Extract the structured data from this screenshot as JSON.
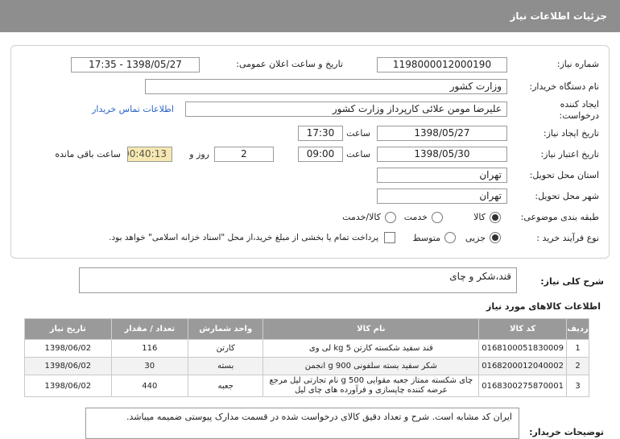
{
  "header": {
    "title": "جزئیات اطلاعات نیاز"
  },
  "form": {
    "need_number_label": "شماره نیاز:",
    "need_number": "1198000012000190",
    "announce_label": "تاریخ و ساعت اعلان عمومی:",
    "announce_value": "1398/05/27 - 17:35",
    "buyer_org_label": "نام دستگاه خریدار:",
    "buyer_org": "وزارت کشور",
    "creator_label_1": "ایجاد کننده",
    "creator_label_2": "درخواست:",
    "creator": "علیرضا مومن علائی کارپرداز وزارت کشور",
    "contact_link": "اطلاعات تماس خریدار",
    "created_date_label": "تاریخ ایجاد نیاز:",
    "created_date": "1398/05/27",
    "time_label": "ساعت",
    "created_time": "17:30",
    "valid_date_label": "تاریخ اعتبار نیاز:",
    "valid_date": "1398/05/30",
    "valid_time": "09:00",
    "days": "2",
    "days_label": "روز و",
    "remaining_time": "00:40:13",
    "remaining_label": "ساعت باقی مانده",
    "province_label": "استان محل تحویل:",
    "province": "تهران",
    "city_label": "شهر محل تحویل:",
    "city": "تهران",
    "category_label": "طبقه بندی موضوعی:",
    "category_options": [
      "کالا",
      "خدمت",
      "کالا/خدمت"
    ],
    "category_selected": 0,
    "process_label": "نوع فرآیند خرید :",
    "process_options": [
      "جزیی",
      "متوسط"
    ],
    "process_selected": 0,
    "payment_note": "پرداخت تمام یا بخشی از مبلغ خرید،از محل \"اسناد خزانه اسلامی\" خواهد بود."
  },
  "summary": {
    "label": "شرح کلی نیاز:",
    "value": "قند،شکر و چای"
  },
  "items_section": {
    "title": "اطلاعات کالاهای مورد نیاز",
    "columns": [
      "ردیف",
      "کد کالا",
      "نام کالا",
      "واحد شمارش",
      "تعداد / مقدار",
      "تاریخ نیاز"
    ],
    "rows": [
      [
        "1",
        "0168100051830009",
        "قند سفید شکسته کارتن 5 kg لی وی",
        "کارتن",
        "116",
        "1398/06/02"
      ],
      [
        "2",
        "0168200012040002",
        "شکر سفید بسته سلفونی 900 g انجمن",
        "بسته",
        "30",
        "1398/06/02"
      ],
      [
        "3",
        "0168300275870001",
        "چای شکسته ممتاز جعبه مقوایی 500 g نام تجارتی لیل مرجع عرضه کننده چاپسازی و فرآورده های چای لیل",
        "جعبه",
        "440",
        "1398/06/02"
      ]
    ]
  },
  "description": {
    "label": "توضیحات خریدار:",
    "text": "ایران کد مشابه است. شرح و تعداد دقیق کالای درخواست شده در قسمت مدارک پیوستی ضمیمه میباشد."
  }
}
